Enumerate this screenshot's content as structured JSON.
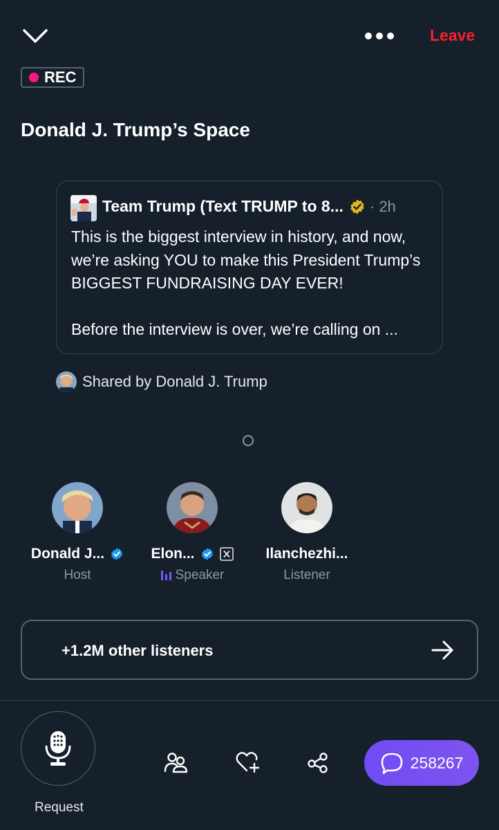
{
  "topbar": {
    "leave_label": "Leave"
  },
  "recording": {
    "label": "REC"
  },
  "space": {
    "title": "Donald J. Trump’s Space"
  },
  "quoted_tweet": {
    "author": "Team Trump (Text TRUMP to 8...",
    "time": "· 2h",
    "paragraph1": "This is the biggest interview in history, and now, we’re asking YOU to make this President Trump’s BIGGEST FUNDRAISING DAY EVER!",
    "paragraph2": "Before the interview is over, we’re calling on ..."
  },
  "shared_by": {
    "label": "Shared by Donald J. Trump"
  },
  "participants": [
    {
      "name": "Donald J...",
      "role": "Host"
    },
    {
      "name": "Elon...",
      "role": "Speaker"
    },
    {
      "name": "Ilanchezhi...",
      "role": "Listener"
    }
  ],
  "listeners": {
    "label": "+1.2M other listeners"
  },
  "footer": {
    "request_label": "Request",
    "comment_count": "258267"
  },
  "colors": {
    "background": "#15202b",
    "leave": "#f4212e",
    "rec_dot": "#f91880",
    "verified_blue": "#1d9bf0",
    "verified_gold": "#e2b719",
    "comments_button": "#7052f3",
    "muted_text": "#8b98a5"
  },
  "icons": {
    "collapse": "chevron-down-icon",
    "more": "more-icon",
    "mic": "microphone-icon",
    "people": "people-icon",
    "heart": "heart-plus-icon",
    "share": "share-icon",
    "comments": "comment-icon",
    "arrow": "arrow-right-icon",
    "x_badge": "x-logo-icon",
    "speaking": "speaking-bars-icon"
  }
}
